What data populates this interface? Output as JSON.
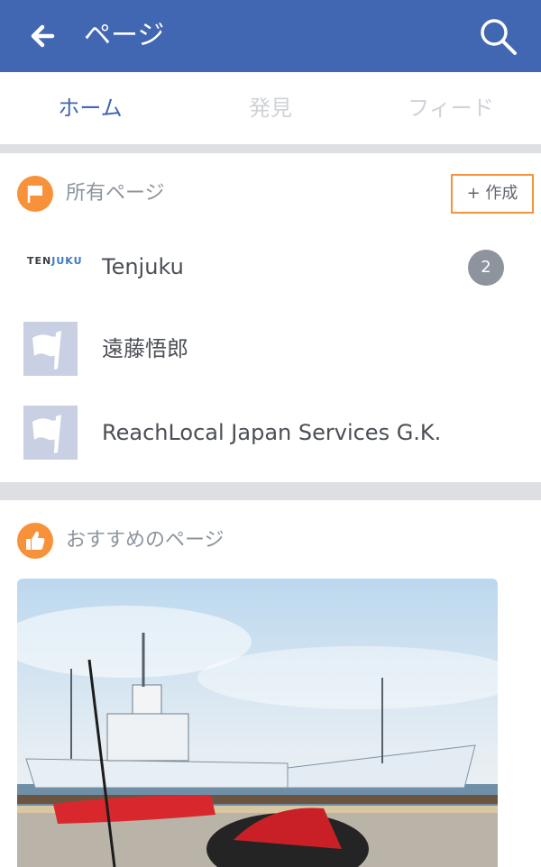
{
  "header": {
    "title": "ページ",
    "back_icon": "back-arrow-icon",
    "search_icon": "search-icon",
    "color": "#4267b2"
  },
  "tabs": [
    {
      "label": "ホーム",
      "active": true
    },
    {
      "label": "発見",
      "active": false
    },
    {
      "label": "フィード",
      "active": false
    }
  ],
  "owned": {
    "title": "所有ページ",
    "icon": "flag-icon",
    "create_label": "+ 作成",
    "pages": [
      {
        "name": "Tenjuku",
        "logo": {
          "part1": "TEN",
          "part2": "JUKU"
        },
        "badge": "2"
      },
      {
        "name": "遠藤悟郎",
        "thumb_icon": "flag-icon"
      },
      {
        "name": "ReachLocal Japan Services G.K.",
        "thumb_icon": "flag-icon"
      }
    ]
  },
  "recommended": {
    "title": "おすすめのページ",
    "icon": "thumbs-up-icon"
  },
  "accent_color": "#f7923a"
}
